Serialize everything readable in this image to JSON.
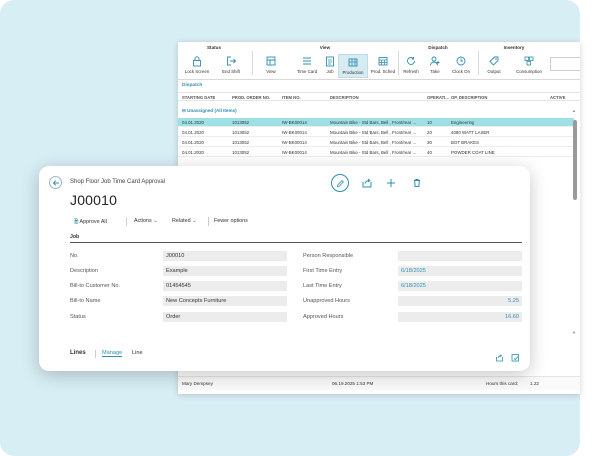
{
  "ribbon": {
    "status_title": "Status",
    "view_title": "View",
    "dispatch_title": "Dispatch",
    "inventory_title": "Inventory",
    "buttons": {
      "lock_screen": "Lock Screen",
      "end_shift": "End Shift",
      "view": "View",
      "time_card": "Time Card",
      "job": "Job",
      "production": "Production",
      "prod_sched": "Prod. Sched",
      "refresh": "Refresh",
      "take": "Take",
      "clock_on": "Clock On",
      "output": "Output",
      "consumption": "Consumption"
    }
  },
  "dispatch": {
    "label": "Dispatch",
    "columns": [
      "STARTING DATE",
      "PROD. ORDER NO.",
      "ITEM NO.",
      "DESCRIPTION",
      "OPERATI...",
      "OP. DESCRIPTION",
      "ACTIVE"
    ],
    "group_label": "Unassigned (All Items)",
    "rows": [
      {
        "date": "04.01.2020",
        "order": "1013052",
        "item": "IW-BK00014",
        "desc": "Mountain Bike - Std Bars, Bell , Front/rear ...",
        "op": "10",
        "opdesc": "Engineering"
      },
      {
        "date": "04.01.2020",
        "order": "1013052",
        "item": "IW-BK00014",
        "desc": "Mountain Bike - Std Bars, Bell , Front/rear ...",
        "op": "20",
        "opdesc": "4080 WATT LASER"
      },
      {
        "date": "04.01.2020",
        "order": "1013052",
        "item": "IW-BK00014",
        "desc": "Mountain Bike - Std Bars, Bell , Front/rear ...",
        "op": "30",
        "opdesc": "BOT BRAKES"
      },
      {
        "date": "04.01.2020",
        "order": "1013052",
        "item": "IW-BK00014",
        "desc": "Mountain Bike - Std Bars, Bell , Front/rear ...",
        "op": "40",
        "opdesc": "POWDER COAT LINE"
      }
    ],
    "footer": {
      "user": "Mary Dempsey",
      "datetime": "06.19.2025 1:53 PM",
      "hours_label": "Hours this card:",
      "hours_value": "1.22"
    }
  },
  "card": {
    "breadcrumb": "Shop Floor Job Time Card Approval",
    "title": "J00010",
    "actions": {
      "approve_all": "Approve All",
      "actions": "Actions",
      "related": "Related",
      "fewer_options": "Fewer options"
    },
    "section": "Job",
    "fields_left": [
      {
        "label": "No.",
        "value": "J00010"
      },
      {
        "label": "Description",
        "value": "Example"
      },
      {
        "label": "Bill-to Customer No.",
        "value": "01454545"
      },
      {
        "label": "Bill-to Name",
        "value": "New Concepts Furniture"
      },
      {
        "label": "Status",
        "value": "Order"
      }
    ],
    "fields_right": [
      {
        "label": "Person Responsible",
        "value": ""
      },
      {
        "label": "First Time Entry",
        "value": "6/18/2025"
      },
      {
        "label": "Last Time Entry",
        "value": "6/18/2025"
      },
      {
        "label": "Unapproved Hours",
        "value": "5.25"
      },
      {
        "label": "Approved Hours",
        "value": "16.60"
      }
    ],
    "lines": {
      "title": "Lines",
      "tab_manage": "Manage",
      "tab_line": "Line"
    }
  }
}
